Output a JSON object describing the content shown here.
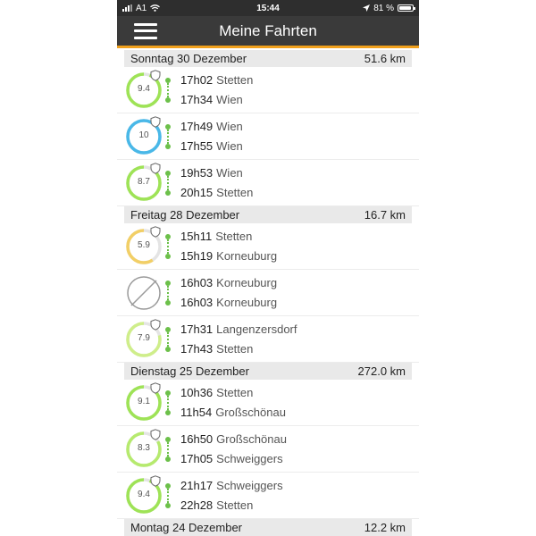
{
  "status": {
    "carrier": "A1",
    "time": "15:44",
    "battery": "81 %",
    "battery_level": 0.81
  },
  "header": {
    "title": "Meine Fahrten"
  },
  "days": [
    {
      "label": "Sonntag 30 Dezember",
      "distance": "51.6 km",
      "trips": [
        {
          "score": "9.4",
          "score_fraction": 0.94,
          "color": "#9ee356",
          "start_time": "17h02",
          "start_place": "Stetten",
          "end_time": "17h34",
          "end_place": "Wien"
        },
        {
          "score": "10",
          "score_fraction": 1.0,
          "color": "#49b8e8",
          "start_time": "17h49",
          "start_place": "Wien",
          "end_time": "17h55",
          "end_place": "Wien"
        },
        {
          "score": "8.7",
          "score_fraction": 0.87,
          "color": "#9ee356",
          "start_time": "19h53",
          "start_place": "Wien",
          "end_time": "20h15",
          "end_place": "Stetten"
        }
      ]
    },
    {
      "label": "Freitag 28 Dezember",
      "distance": "16.7 km",
      "trips": [
        {
          "score": "5.9",
          "score_fraction": 0.59,
          "color": "#f2cf66",
          "start_time": "15h11",
          "start_place": "Stetten",
          "end_time": "15h19",
          "end_place": "Korneuburg"
        },
        {
          "score": "",
          "score_fraction": 0,
          "color": "#9a9a9a",
          "no_score": true,
          "start_time": "16h03",
          "start_place": "Korneuburg",
          "end_time": "16h03",
          "end_place": "Korneuburg"
        },
        {
          "score": "7.9",
          "score_fraction": 0.79,
          "color": "#cfee8a",
          "start_time": "17h31",
          "start_place": "Langenzersdorf",
          "end_time": "17h43",
          "end_place": "Stetten"
        }
      ]
    },
    {
      "label": "Dienstag 25 Dezember",
      "distance": "272.0 km",
      "trips": [
        {
          "score": "9.1",
          "score_fraction": 0.91,
          "color": "#9ee356",
          "start_time": "10h36",
          "start_place": "Stetten",
          "end_time": "11h54",
          "end_place": "Großschönau"
        },
        {
          "score": "8.3",
          "score_fraction": 0.83,
          "color": "#b6ea6e",
          "start_time": "16h50",
          "start_place": "Großschönau",
          "end_time": "17h05",
          "end_place": "Schweiggers"
        },
        {
          "score": "9.4",
          "score_fraction": 0.94,
          "color": "#9ee356",
          "start_time": "21h17",
          "start_place": "Schweiggers",
          "end_time": "22h28",
          "end_place": "Stetten"
        }
      ]
    },
    {
      "label": "Montag 24 Dezember",
      "distance": "12.2 km",
      "trips": []
    }
  ]
}
